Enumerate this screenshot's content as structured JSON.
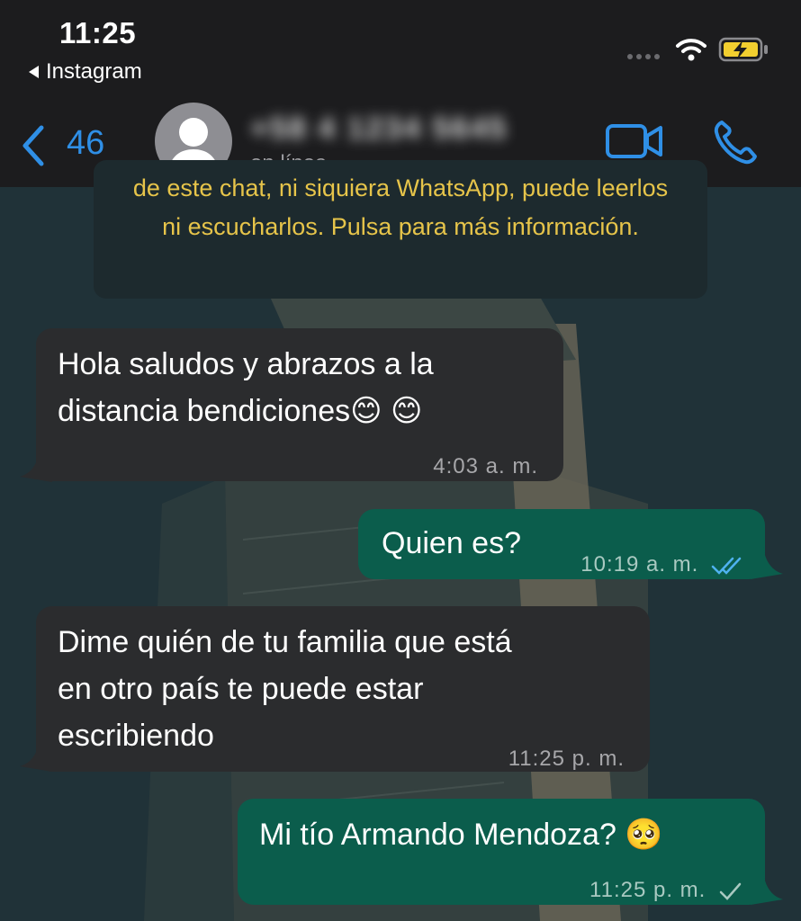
{
  "status_bar": {
    "time": "11:25",
    "back_app": "Instagram"
  },
  "header": {
    "unread_count": "46",
    "contact_name": "+58 4 1234 5645",
    "contact_status": "en línea"
  },
  "notice": {
    "text": "de este chat, ni siquiera WhatsApp, puede leerlos ni escucharlos. Pulsa para más información."
  },
  "messages": [
    {
      "direction": "in",
      "text_line1": "Hola saludos y abrazos a la",
      "text_line2": "distancia bendiciones😊 😊",
      "time": "4:03 a. m."
    },
    {
      "direction": "out",
      "text_line1": "Quien es?",
      "time": "10:19 a. m.",
      "status": "read"
    },
    {
      "direction": "in",
      "text_line1": "Dime quién de tu familia que está",
      "text_line2": "en otro país te puede estar",
      "text_line3": "escribiendo",
      "time": "11:25 p. m."
    },
    {
      "direction": "out",
      "text_line1": "Mi tío Armando Mendoza? 🥺",
      "time": "11:25 p. m.",
      "status": "sent"
    }
  ],
  "colors": {
    "accent_blue": "#2f8fe6",
    "outgoing_bubble": "#0b5d4c",
    "incoming_bubble": "#2b2c2e",
    "notice_text": "#e6c44a"
  },
  "icons": [
    "wifi-icon",
    "battery-charging-icon",
    "back-chevron-icon",
    "video-call-icon",
    "phone-call-icon",
    "read-receipt-icon",
    "sent-check-icon"
  ]
}
